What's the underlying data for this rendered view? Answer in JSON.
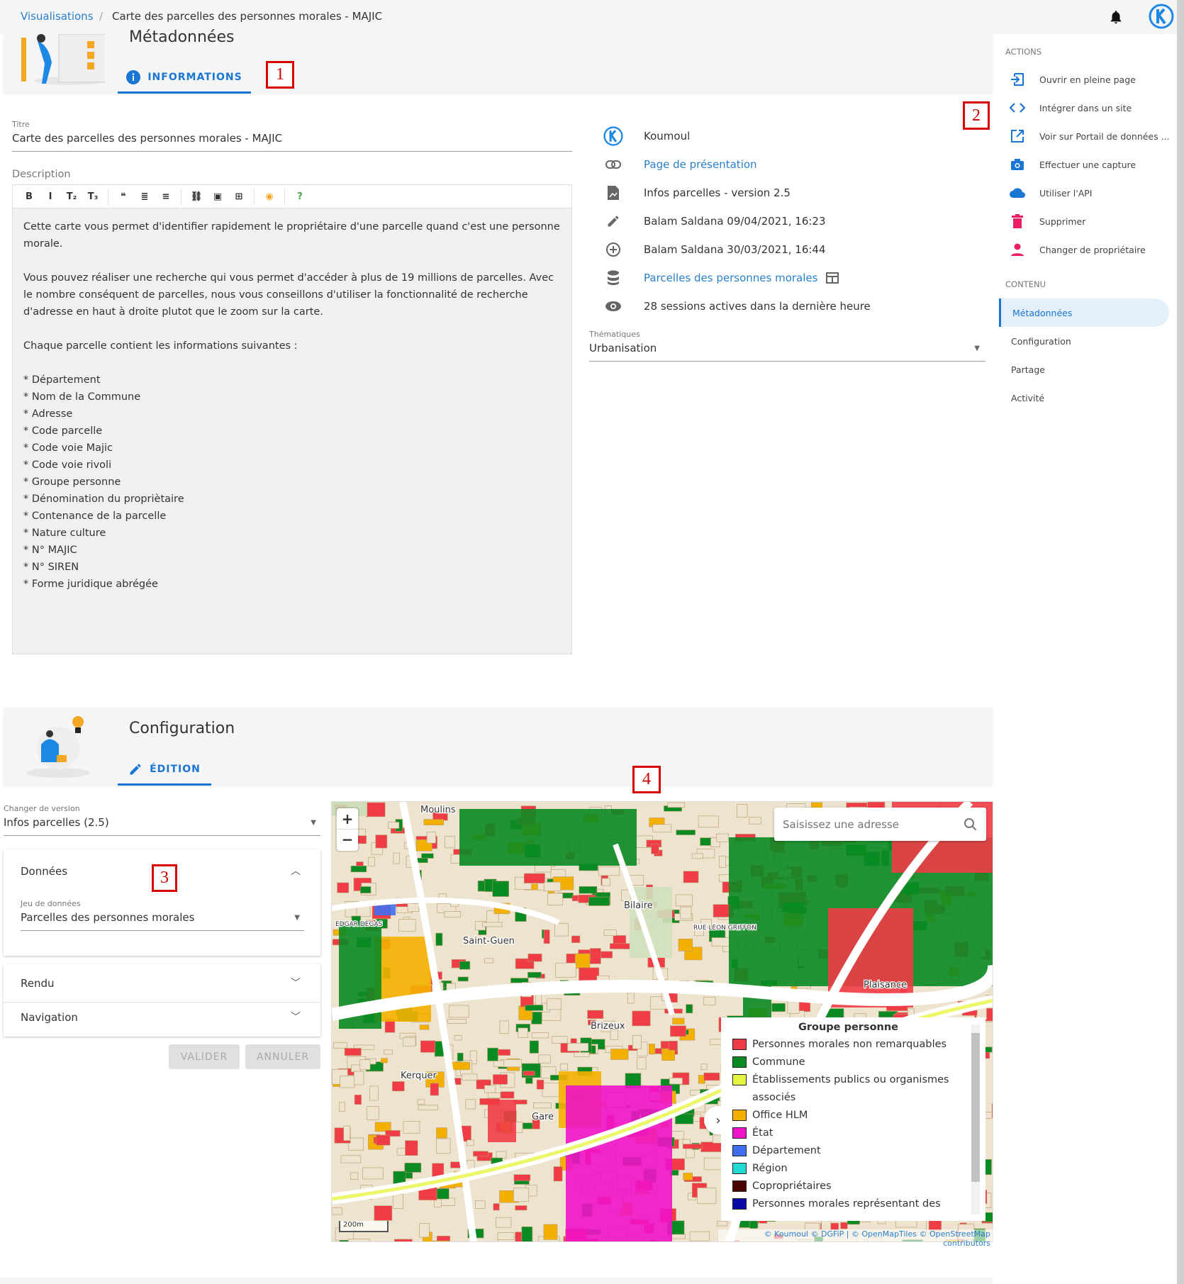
{
  "breadcrumb": {
    "root": "Visualisations",
    "separator": "/",
    "current": "Carte des parcelles des personnes morales - MAJIC"
  },
  "header": {
    "notifications_icon": "bell-icon",
    "logo_icon": "koumoul-logo"
  },
  "metadata": {
    "section_title": "Métadonnées",
    "tab": "INFORMATIONS",
    "marker": "1",
    "title_label": "Titre",
    "title_value": "Carte des parcelles des personnes morales - MAJIC",
    "description_label": "Description",
    "toolbar": [
      "B",
      "I",
      "T₂",
      "T₃",
      "❝",
      "≣",
      "≡",
      "⛓",
      "▣",
      "⊞",
      "◉",
      "?"
    ],
    "description": "Cette carte vous permet d'identifier rapidement le propriétaire d'une parcelle quand c'est une personne morale.\n\nVous pouvez réaliser une recherche qui vous permet d'accéder à plus de 19 millions de parcelles. Avec le nombre conséquent de parcelles, nous vous conseillons d'utiliser la fonctionnalité de recherche d'adresse en haut à droite plutot que le zoom sur la carte.\n\nChaque parcelle contient les informations suivantes :\n\n* Département\n* Nom de la Commune\n* Adresse\n* Code parcelle\n* Code voie Majic\n* Code voie rivoli\n* Groupe personne\n* Dénomination du propriètaire\n* Contenance de la parcelle\n* Nature culture\n* N° MAJIC\n* N° SIREN\n* Forme juridique abrégée",
    "marker2": "2",
    "info": [
      {
        "icon": "koumoul-icon",
        "text": "Koumoul",
        "link": false
      },
      {
        "icon": "link-icon",
        "text": "Page de présentation",
        "link": true
      },
      {
        "icon": "file-chart-icon",
        "text": "Infos parcelles - version 2.5",
        "link": false
      },
      {
        "icon": "pencil-icon",
        "text": "Balam Saldana 09/04/2021, 16:23",
        "link": false
      },
      {
        "icon": "plus-circle-icon",
        "text": "Balam Saldana 30/03/2021, 16:44",
        "link": false
      },
      {
        "icon": "database-icon",
        "text": "Parcelles des personnes morales",
        "link": true
      },
      {
        "icon": "eye-icon",
        "text": "28 sessions actives dans la dernière heure",
        "link": false
      }
    ],
    "thematiques_label": "Thématiques",
    "thematiques_value": "Urbanisation"
  },
  "sidebar": {
    "actions_title": "ACTIONS",
    "actions": [
      {
        "icon": "open-page-icon",
        "label": "Ouvrir en pleine page",
        "color": "#1976d2"
      },
      {
        "icon": "code-icon",
        "label": "Intégrer dans un site",
        "color": "#1976d2"
      },
      {
        "icon": "external-link-icon",
        "label": "Voir sur Portail de données ...",
        "color": "#1976d2"
      },
      {
        "icon": "camera-icon",
        "label": "Effectuer une capture",
        "color": "#1976d2"
      },
      {
        "icon": "cloud-icon",
        "label": "Utiliser l'API",
        "color": "#1976d2"
      },
      {
        "icon": "trash-icon",
        "label": "Supprimer",
        "color": "#e91e63"
      },
      {
        "icon": "account-icon",
        "label": "Changer de propriétaire",
        "color": "#e91e63"
      }
    ],
    "content_title": "CONTENU",
    "content": [
      "Métadonnées",
      "Configuration",
      "Partage",
      "Activité"
    ],
    "active": "Métadonnées"
  },
  "config": {
    "section_title": "Configuration",
    "tab": "ÉDITION",
    "marker4": "4",
    "marker3": "3",
    "version_label": "Changer de version",
    "version_value": "Infos parcelles (2.5)",
    "panels": {
      "data": "Données",
      "render": "Rendu",
      "navigation": "Navigation"
    },
    "dataset_label": "Jeu de données",
    "dataset_value": "Parcelles des personnes morales",
    "validate": "VALIDER",
    "cancel": "ANNULER"
  },
  "map": {
    "search_placeholder": "Saisissez une adresse",
    "zoom_in": "+",
    "zoom_out": "−",
    "scale": "200m",
    "place_labels": [
      "Moulins",
      "Bilaire",
      "Saint-Guen",
      "Brizeux",
      "Kerquer",
      "Gare",
      "Plaisance",
      "RUE LÉON GRIFFON",
      "EDGAR DEGAS"
    ],
    "attribution": "© Koumoul © DGFiP | © OpenMapTiles © OpenStreetMap contributors",
    "legend": {
      "title": "Groupe personne",
      "items": [
        {
          "label": "Personnes morales non remarquables",
          "color": "#f03c46"
        },
        {
          "label": "Commune",
          "color": "#0a8a22"
        },
        {
          "label": "Établissements publics ou organismes associés",
          "color": "#e6f542"
        },
        {
          "label": "Office HLM",
          "color": "#f4b000"
        },
        {
          "label": "État",
          "color": "#f012c8"
        },
        {
          "label": "Département",
          "color": "#3f6ff0"
        },
        {
          "label": "Région",
          "color": "#22d8d2"
        },
        {
          "label": "Copropriétaires",
          "color": "#4a0000"
        },
        {
          "label": "Personnes morales représentant des",
          "color": "#0a0aa8"
        }
      ]
    }
  }
}
